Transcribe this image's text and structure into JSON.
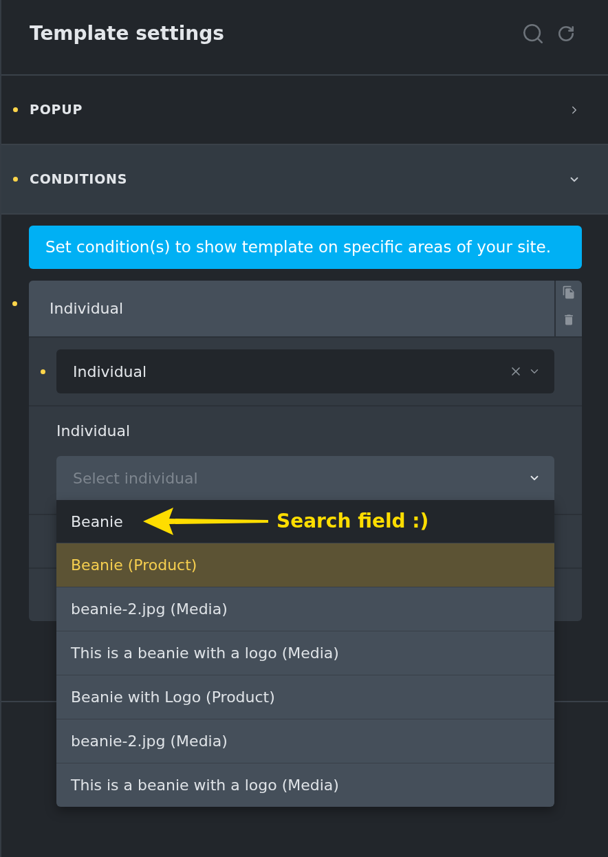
{
  "header": {
    "title": "Template settings"
  },
  "sections": [
    {
      "label": "POPUP",
      "changed": true,
      "expanded": false
    },
    {
      "label": "CONDITIONS",
      "changed": true,
      "expanded": true
    }
  ],
  "conditions": {
    "info": "Set condition(s) to show template on specific areas of your site.",
    "items": [
      {
        "title": "Individual",
        "changed": true,
        "type_select": {
          "value": "Individual",
          "changed": true
        },
        "field_label": "Individual",
        "individual_select": {
          "placeholder": "Select individual",
          "open": true,
          "search": {
            "value": "Beanie"
          },
          "options": [
            {
              "label": "Beanie (Product)",
              "selected": true
            },
            {
              "label": "beanie-2.jpg (Media)",
              "selected": false
            },
            {
              "label": "This is a beanie with a logo (Media)",
              "selected": false
            },
            {
              "label": "Beanie with Logo (Product)",
              "selected": false
            },
            {
              "label": "beanie-2.jpg (Media)",
              "selected": false
            },
            {
              "label": "This is a beanie with a logo (Media)",
              "selected": false
            }
          ]
        }
      }
    ]
  },
  "annotation": {
    "text": "Search field :)"
  }
}
